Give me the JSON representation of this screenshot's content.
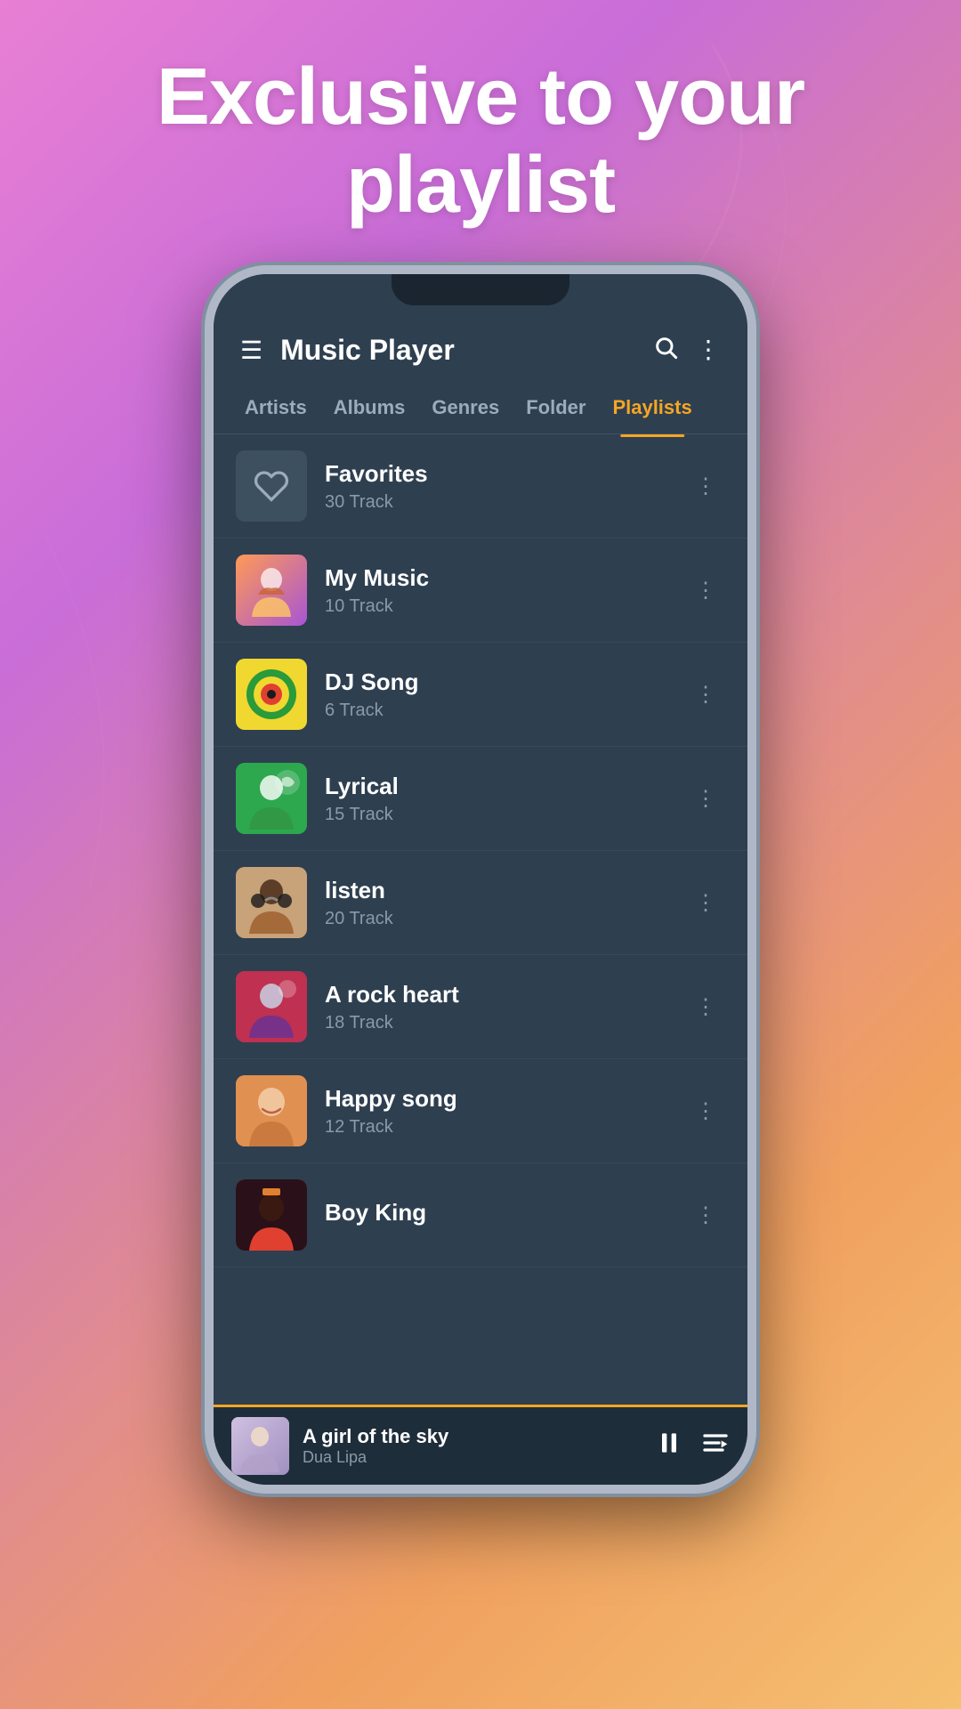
{
  "background": {
    "gradient_start": "#e87fd4",
    "gradient_end": "#f5c070"
  },
  "header": {
    "title": "Exclusive to your playlist"
  },
  "app": {
    "title": "Music Player"
  },
  "nav": {
    "tabs": [
      {
        "label": "Artists",
        "active": false
      },
      {
        "label": "Albums",
        "active": false
      },
      {
        "label": "Genres",
        "active": false
      },
      {
        "label": "Folder",
        "active": false
      },
      {
        "label": "Playlists",
        "active": true
      }
    ]
  },
  "playlists": [
    {
      "name": "Favorites",
      "tracks": "30 Track",
      "thumb_type": "favorites"
    },
    {
      "name": "My Music",
      "tracks": "10 Track",
      "thumb_type": "mymusic"
    },
    {
      "name": "DJ Song",
      "tracks": "6 Track",
      "thumb_type": "djsong"
    },
    {
      "name": "Lyrical",
      "tracks": "15 Track",
      "thumb_type": "lyrical"
    },
    {
      "name": "listen",
      "tracks": "20 Track",
      "thumb_type": "listen"
    },
    {
      "name": "A rock heart",
      "tracks": "18 Track",
      "thumb_type": "arockheart"
    },
    {
      "name": "Happy song",
      "tracks": "12 Track",
      "thumb_type": "happysong"
    },
    {
      "name": "Boy King",
      "tracks": "",
      "thumb_type": "boyking"
    }
  ],
  "now_playing": {
    "title": "A girl of the sky",
    "artist": "Dua Lipa"
  },
  "icons": {
    "hamburger": "☰",
    "search": "🔍",
    "more_vert": "⋮",
    "pause": "⏸",
    "queue": "≡",
    "heart": "♡",
    "vinyl": "●"
  }
}
